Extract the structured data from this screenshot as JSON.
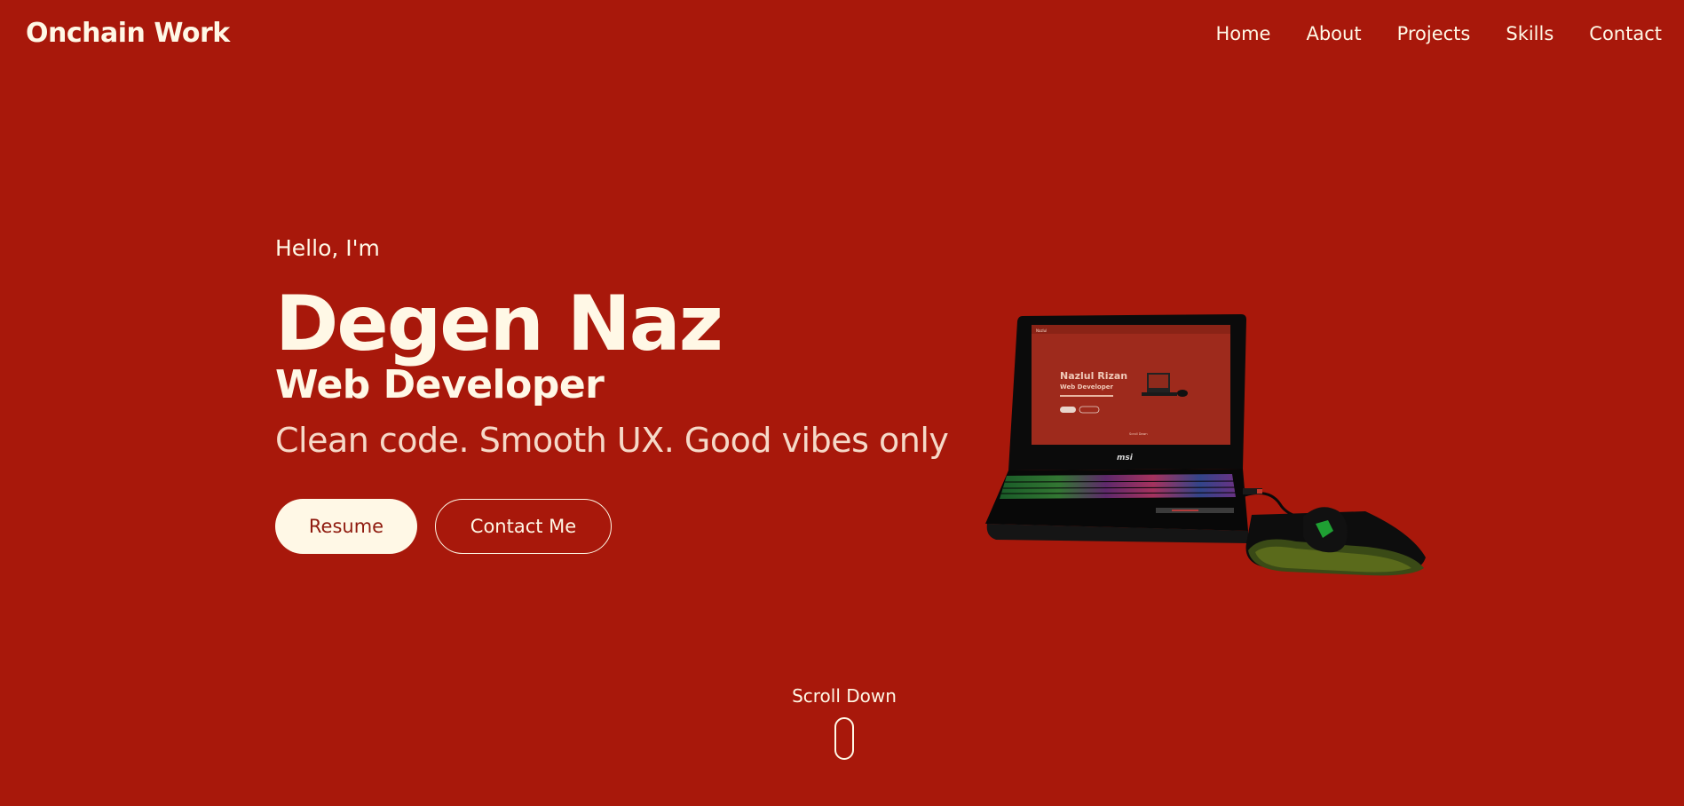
{
  "header": {
    "brand": "Onchain Work",
    "nav": [
      "Home",
      "About",
      "Projects",
      "Skills",
      "Contact"
    ]
  },
  "hero": {
    "greeting": "Hello, I'm",
    "name": "Degen Naz",
    "role": "Web Developer",
    "tagline": "Clean code. Smooth UX. Good vibes only",
    "primary_button": "Resume",
    "secondary_button": "Contact Me"
  },
  "illustration": {
    "icon": "laptop-with-mouse-illustration",
    "screen_title": "Nazlul Rizan",
    "screen_subtitle": "Web Developer",
    "brand_badge": "msi"
  },
  "scroll": {
    "label": "Scroll Down",
    "icon": "mouse-icon"
  },
  "colors": {
    "background": "#a8180b",
    "text": "#fff8e6",
    "button_text": "#8f1a0e"
  }
}
